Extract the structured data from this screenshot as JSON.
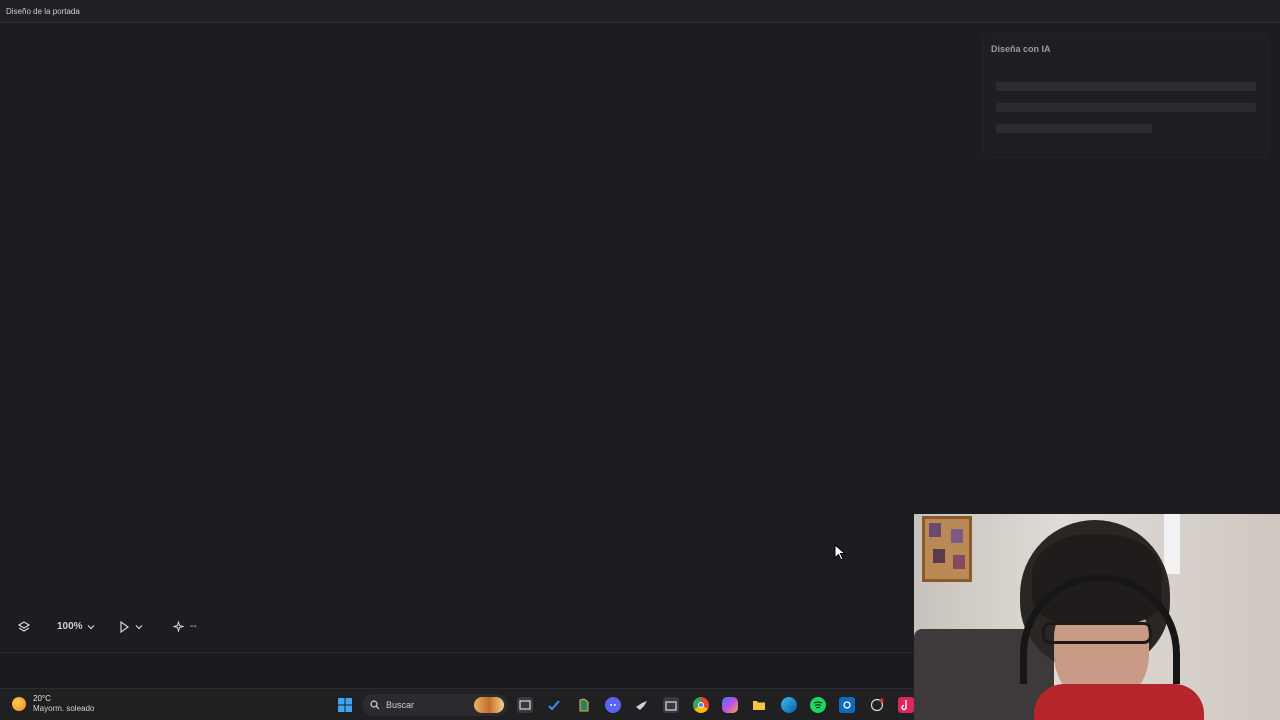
{
  "window": {
    "title": "Diseño de la portada"
  },
  "ai_panel": {
    "title": "Diseña con IA"
  },
  "toolbar": {
    "layers_icon": "layers-icon",
    "zoom_value": "100%",
    "zoom_chevron": "chevron-down-icon",
    "pointer_icon": "cursor-arrow-icon",
    "sparkle_icon": "sparkle-icon",
    "sparkle_value": "--"
  },
  "taskbar": {
    "weather": {
      "temp": "20°C",
      "condition": "Mayorm. soleado"
    },
    "search_placeholder": "Buscar",
    "icons": [
      "windows-start-icon",
      "search-icon",
      "task-view-icon",
      "todo-icon",
      "app-icon",
      "discord-icon",
      "steam-icon",
      "store-icon",
      "chrome-icon",
      "copilot-icon",
      "file-explorer-icon",
      "edge-icon",
      "spotify-icon",
      "outlook-icon",
      "app-icon",
      "tiktok-icon"
    ]
  }
}
